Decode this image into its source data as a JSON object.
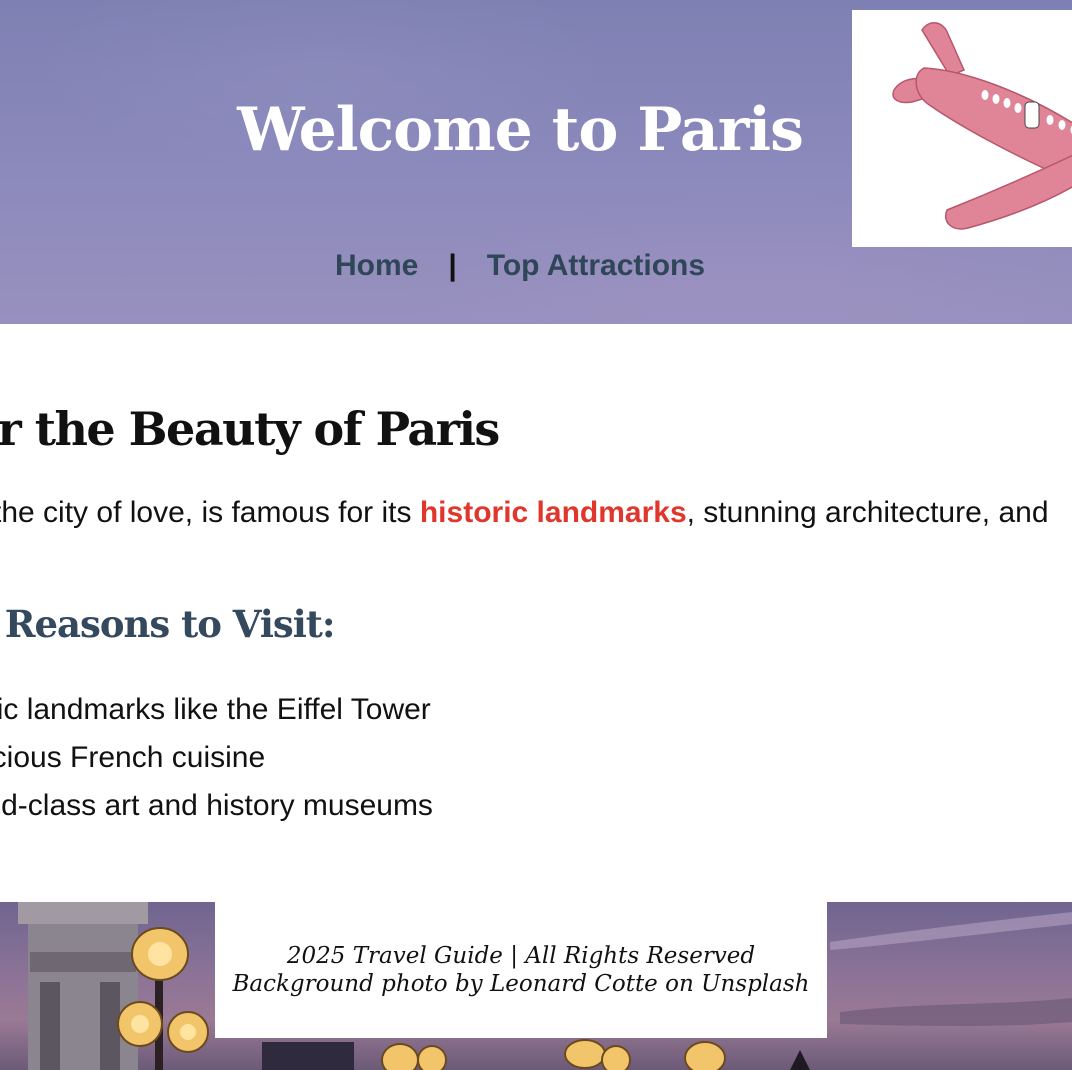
{
  "header": {
    "title": "Welcome to Paris",
    "nav": {
      "home_label": "Home",
      "separator": "|",
      "attractions_label": "Top Attractions"
    },
    "logo_icon": "airplane-icon"
  },
  "main": {
    "heading": "Discover the Beauty of Paris",
    "intro": {
      "before": "Paris, the city of love, is famous for its ",
      "highlight": "historic landmarks",
      "after": ", stunning architecture, and"
    },
    "reasons_heading": "Top Reasons to Visit:",
    "reasons": [
      "Iconic landmarks like the Eiffel Tower",
      "Delicious French cuisine",
      "World-class art and history museums"
    ]
  },
  "footer": {
    "line1": "2025 Travel Guide | All Rights Reserved",
    "line2": "Background photo by Leonard Cotte on Unsplash"
  },
  "colors": {
    "header_bg": "#8a88bb",
    "nav_link": "#2f4658",
    "highlight": "#e0362c",
    "subheading": "#34495e",
    "plane": "#e08597"
  }
}
